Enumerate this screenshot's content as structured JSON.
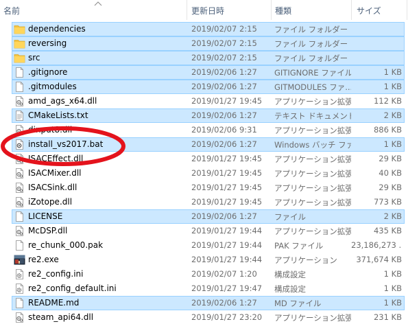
{
  "columns": {
    "name": "名前",
    "date": "更新日時",
    "type": "種類",
    "size": "サイズ"
  },
  "files": [
    {
      "name": "dependencies",
      "date": "2019/02/07 2:15",
      "type": "ファイル フォルダー",
      "size": "",
      "icon": "folder-icon",
      "selected": true
    },
    {
      "name": "reversing",
      "date": "2019/02/07 2:15",
      "type": "ファイル フォルダー",
      "size": "",
      "icon": "folder-icon",
      "selected": true
    },
    {
      "name": "src",
      "date": "2019/02/07 2:15",
      "type": "ファイル フォルダー",
      "size": "",
      "icon": "folder-icon",
      "selected": true
    },
    {
      "name": ".gitignore",
      "date": "2019/02/06 1:27",
      "type": "GITIGNORE ファイル",
      "size": "1 KB",
      "icon": "blank-file-icon",
      "selected": true
    },
    {
      "name": ".gitmodules",
      "date": "2019/02/06 1:27",
      "type": "GITMODULES ファ...",
      "size": "1 KB",
      "icon": "blank-file-icon",
      "selected": true
    },
    {
      "name": "amd_ags_x64.dll",
      "date": "2019/01/27 19:45",
      "type": "アプリケーション拡張",
      "size": "112 KB",
      "icon": "dll-file-icon",
      "selected": false
    },
    {
      "name": "CMakeLists.txt",
      "date": "2019/02/06 1:27",
      "type": "テキスト ドキュメント",
      "size": "2 KB",
      "icon": "text-file-icon",
      "selected": true
    },
    {
      "name": "dinput8.dll",
      "date": "2019/02/06 9:31",
      "type": "アプリケーション拡張",
      "size": "886 KB",
      "icon": "dll-file-icon",
      "selected": false
    },
    {
      "name": "install_vs2017.bat",
      "date": "2019/02/06 1:27",
      "type": "Windows バッチ ファ...",
      "size": "1 KB",
      "icon": "batch-file-icon",
      "selected": true
    },
    {
      "name": "ISACEffect.dll",
      "date": "2019/01/27 19:45",
      "type": "アプリケーション拡張",
      "size": "29 KB",
      "icon": "dll-file-icon",
      "selected": false
    },
    {
      "name": "ISACMixer.dll",
      "date": "2019/01/27 19:45",
      "type": "アプリケーション拡張",
      "size": "40 KB",
      "icon": "dll-file-icon",
      "selected": false
    },
    {
      "name": "ISACSink.dll",
      "date": "2019/01/27 19:45",
      "type": "アプリケーション拡張",
      "size": "29 KB",
      "icon": "dll-file-icon",
      "selected": false
    },
    {
      "name": "iZotope.dll",
      "date": "2019/01/27 19:45",
      "type": "アプリケーション拡張",
      "size": "773 KB",
      "icon": "dll-file-icon",
      "selected": false
    },
    {
      "name": "LICENSE",
      "date": "2019/02/06 1:27",
      "type": "ファイル",
      "size": "2 KB",
      "icon": "blank-file-icon",
      "selected": true
    },
    {
      "name": "McDSP.dll",
      "date": "2019/01/27 19:44",
      "type": "アプリケーション拡張",
      "size": "435 KB",
      "icon": "dll-file-icon",
      "selected": false
    },
    {
      "name": "re_chunk_000.pak",
      "date": "2019/01/27 19:44",
      "type": "PAK ファイル",
      "size": "23,186,273 ...",
      "icon": "blank-file-icon",
      "selected": false
    },
    {
      "name": "re2.exe",
      "date": "2019/01/27 19:44",
      "type": "アプリケーション",
      "size": "371,674 KB",
      "icon": "exe-app-icon",
      "selected": false
    },
    {
      "name": "re2_config.ini",
      "date": "2019/02/07 1:20",
      "type": "構成設定",
      "size": "1 KB",
      "icon": "config-file-icon",
      "selected": false
    },
    {
      "name": "re2_config_default.ini",
      "date": "2019/01/27 19:47",
      "type": "構成設定",
      "size": "1 KB",
      "icon": "config-file-icon",
      "selected": false
    },
    {
      "name": "README.md",
      "date": "2019/02/06 1:27",
      "type": "MD ファイル",
      "size": "1 KB",
      "icon": "blank-file-icon",
      "selected": true
    },
    {
      "name": "steam_api64.dll",
      "date": "2019/01/27 23:20",
      "type": "アプリケーション拡張",
      "size": "231 KB",
      "icon": "dll-file-icon",
      "selected": false
    }
  ],
  "colors": {
    "selection_fill": "#cce8ff",
    "selection_border": "#99d1ff",
    "folder": "#f4c443",
    "annotation_ellipse": "#e4131c"
  }
}
